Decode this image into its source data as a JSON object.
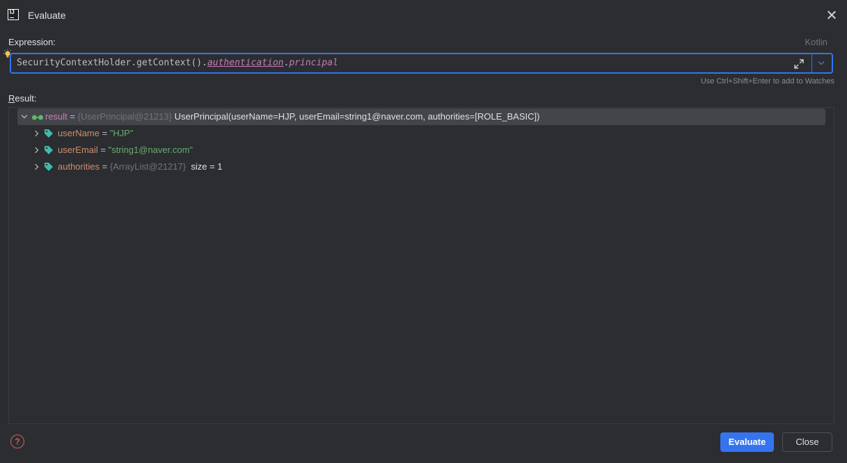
{
  "window": {
    "title": "Evaluate"
  },
  "expression": {
    "label": "Expression:",
    "language": "Kotlin",
    "tokens": {
      "part1": "SecurityContextHolder.getContext().",
      "part2": "authentication",
      "part3": ".",
      "part4": "principal"
    },
    "hint": "Use Ctrl+Shift+Enter to add to Watches"
  },
  "result": {
    "label_first": "R",
    "label_rest": "esult:",
    "root": {
      "name": "result",
      "eq": " = ",
      "ref": "{UserPrincipal@21213}",
      "value": " UserPrincipal(userName=HJP, userEmail=string1@naver.com, authorities=[ROLE_BASIC])"
    },
    "children": [
      {
        "name": "userName",
        "eq": " = ",
        "value": "\"HJP\""
      },
      {
        "name": "userEmail",
        "eq": " = ",
        "value": "\"string1@naver.com\""
      },
      {
        "name": "authorities",
        "eq": " = ",
        "ref": "{ArrayList@21217}",
        "value": "  size = 1"
      }
    ]
  },
  "buttons": {
    "evaluate": "Evaluate",
    "close": "Close",
    "help": "?"
  },
  "colors": {
    "accent": "#3574f0",
    "background": "#2b2d30",
    "string": "#6aab73",
    "field": "#cf8e6d"
  }
}
